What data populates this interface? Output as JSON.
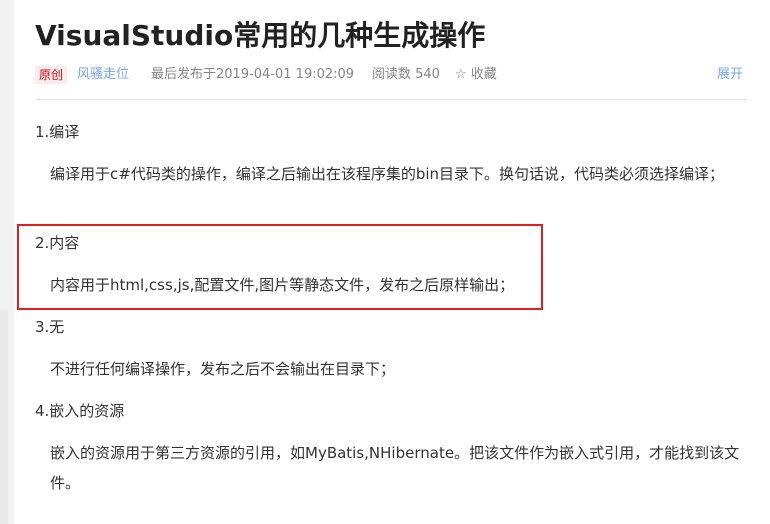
{
  "article": {
    "title": "VisualStudio常用的几种生成操作",
    "meta": {
      "badge": "原创",
      "author": "风骚走位",
      "published": "最后发布于2019-04-01 19:02:09",
      "reads": "阅读数 540",
      "favorite": "☆ 收藏",
      "expand": "展开"
    },
    "sections": [
      {
        "heading": "1.编译",
        "body": "编译用于c#代码类的操作，编译之后输出在该程序集的bin目录下。换句话说，代码类必须选择编译；"
      },
      {
        "heading": "2.内容",
        "body": "内容用于html,css,js,配置文件,图片等静态文件，发布之后原样输出；"
      },
      {
        "heading": "3.无",
        "body": "不进行任何编译操作，发布之后不会输出在目录下；"
      },
      {
        "heading": "4.嵌入的资源",
        "body": "嵌入的资源用于第三方资源的引用，如MyBatis,NHibernate。把该文件作为嵌入式引用，才能找到该文件。"
      }
    ]
  },
  "colors": {
    "badge_bg": "#f9ecec",
    "badge_text": "#ca0c16",
    "link": "#78a5f1",
    "highlight_border": "#e02020"
  }
}
